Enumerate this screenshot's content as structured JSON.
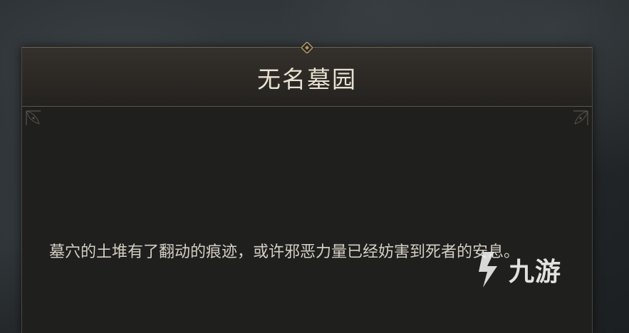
{
  "dialog": {
    "title": "无名墓园",
    "description": "墓穴的土堆有了翻动的痕迹，或许邪恶力量已经妨害到死者的安息。"
  },
  "watermark": {
    "text": "九游"
  },
  "colors": {
    "title_text": "#e8e1d2",
    "body_text": "#d4cfc4",
    "panel_bg": "#1f1f1e",
    "accent_gold": "#b59a6a"
  }
}
